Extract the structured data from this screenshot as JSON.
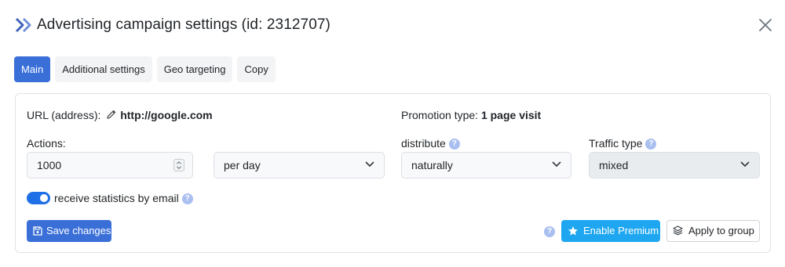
{
  "header": {
    "title": "Advertising campaign settings (id: 2312707)"
  },
  "tabs": [
    {
      "label": "Main",
      "active": true
    },
    {
      "label": "Additional settings",
      "active": false
    },
    {
      "label": "Geo targeting",
      "active": false
    },
    {
      "label": "Copy",
      "active": false
    }
  ],
  "form": {
    "url_label": "URL (address):",
    "url_value": "http://google.com",
    "promotion_label": "Promotion type:",
    "promotion_value": "1 page visit",
    "actions_label": "Actions:",
    "actions_value": "1000",
    "period_value": "per day",
    "distribute_label": "distribute",
    "distribute_value": "naturally",
    "traffic_label": "Traffic type",
    "traffic_value": "mixed",
    "email_stats_label": "receive statistics by email",
    "email_stats_enabled": true
  },
  "buttons": {
    "save": "Save changes",
    "premium": "Enable Premium",
    "apply_group": "Apply to group"
  },
  "colors": {
    "primary": "#3a6fd8",
    "premium": "#1ea7f0",
    "toggle_on": "#1f6fe6",
    "help_badge": "#a9bff0"
  },
  "icons": [
    "double-chevron-right-icon",
    "close-icon",
    "pencil-icon",
    "help-icon",
    "chevron-down-icon",
    "spinner-arrows-icon",
    "floppy-disk-icon",
    "star-icon",
    "layers-icon"
  ]
}
